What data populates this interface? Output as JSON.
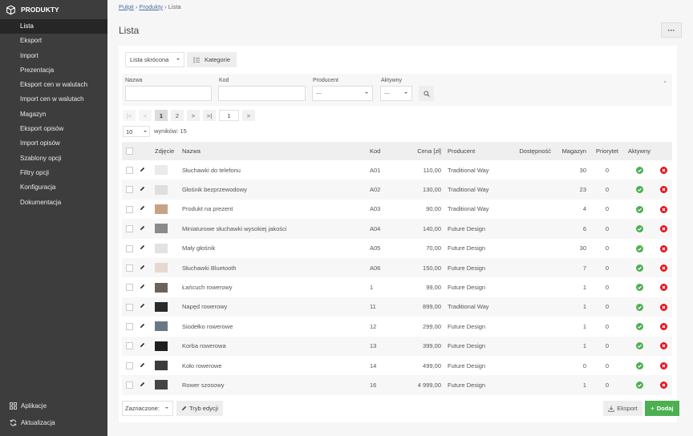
{
  "app": {
    "brand": "PRODUKTY"
  },
  "sidebar": {
    "items": [
      {
        "label": "Lista",
        "active": true
      },
      {
        "label": "Eksport"
      },
      {
        "label": "Import"
      },
      {
        "label": "Prezentacja"
      },
      {
        "label": "Eksport cen w walutach"
      },
      {
        "label": "Import cen w walutach"
      },
      {
        "label": "Magazyn"
      },
      {
        "label": "Eksport opisów"
      },
      {
        "label": "Import opisów"
      },
      {
        "label": "Szablony opcji"
      },
      {
        "label": "Filtry opcji"
      },
      {
        "label": "Konfiguracja"
      },
      {
        "label": "Dokumentacja"
      }
    ],
    "bottom": [
      {
        "label": "Aplikacje",
        "icon": "grid-icon"
      },
      {
        "label": "Aktualizacja",
        "icon": "refresh-icon"
      }
    ]
  },
  "breadcrumb": {
    "items": [
      "Pulpit",
      "Produkty",
      "Lista"
    ],
    "separator": "›"
  },
  "header": {
    "title": "Lista",
    "more_label": "···"
  },
  "toolbar": {
    "view_select": "Lista skrócona",
    "categories_label": "Kategorie"
  },
  "filters": {
    "name_label": "Nazwa",
    "name_value": "",
    "code_label": "Kod",
    "code_value": "",
    "producer_label": "Producent",
    "producer_value": "—",
    "active_label": "Aktywny",
    "active_value": "—"
  },
  "pagination": {
    "first": "|<",
    "prev": "<",
    "pages": [
      "1",
      "2"
    ],
    "current": "1",
    "next": ">",
    "last": ">|",
    "goto_value": "1",
    "goto_btn": ">"
  },
  "per_page": {
    "value": "10",
    "results_label": "wyników: 15"
  },
  "table": {
    "columns": [
      "",
      "",
      "Zdjęcie",
      "Nazwa",
      "Kod",
      "Cena [zł]",
      "Producent",
      "Dostępność",
      "Magazyn",
      "Priorytet",
      "Aktywny",
      ""
    ],
    "rows": [
      {
        "name": "Słuchawki do telefonu",
        "code": "A01",
        "price": "110,00",
        "producer": "Traditional Way",
        "availability": "",
        "stock": "30",
        "priority": "0",
        "active": true,
        "thumb": "#e9ebec"
      },
      {
        "name": "Głośnik bezprzewodowy",
        "code": "A02",
        "price": "130,00",
        "producer": "Traditional Way",
        "availability": "",
        "stock": "23",
        "priority": "0",
        "active": true,
        "thumb": "#dedede"
      },
      {
        "name": "Produkt na prezent",
        "code": "A03",
        "price": "90,00",
        "producer": "Traditional Way",
        "availability": "",
        "stock": "4",
        "priority": "0",
        "active": true,
        "thumb": "#c9a283"
      },
      {
        "name": "Miniaturowe słuchawki wysokiej jakości",
        "code": "A04",
        "price": "140,00",
        "producer": "Future Design",
        "availability": "",
        "stock": "6",
        "priority": "0",
        "active": true,
        "thumb": "#8a8a8a"
      },
      {
        "name": "Mały głośnik",
        "code": "A05",
        "price": "70,00",
        "producer": "Future Design",
        "availability": "",
        "stock": "30",
        "priority": "0",
        "active": true,
        "thumb": "#e2e2e2"
      },
      {
        "name": "Słuchawki Bluetooth",
        "code": "A06",
        "price": "150,00",
        "producer": "Future Design",
        "availability": "",
        "stock": "7",
        "priority": "0",
        "active": true,
        "thumb": "#e8d8cf"
      },
      {
        "name": "Łańcuch rowerowy",
        "code": "1",
        "price": "99,00",
        "producer": "Future Design",
        "availability": "",
        "stock": "1",
        "priority": "0",
        "active": true,
        "thumb": "#6b635b"
      },
      {
        "name": "Napęd rowerowy",
        "code": "11",
        "price": "899,00",
        "producer": "Traditional Way",
        "availability": "",
        "stock": "1",
        "priority": "0",
        "active": true,
        "thumb": "#2a2a2a"
      },
      {
        "name": "Siodełko rowerowe",
        "code": "12",
        "price": "299,00",
        "producer": "Future Design",
        "availability": "",
        "stock": "1",
        "priority": "0",
        "active": true,
        "thumb": "#6a7886"
      },
      {
        "name": "Korba rowerowa",
        "code": "13",
        "price": "399,00",
        "producer": "Future Design",
        "availability": "",
        "stock": "1",
        "priority": "0",
        "active": true,
        "thumb": "#1f1f1f"
      },
      {
        "name": "Koło rowerowe",
        "code": "14",
        "price": "499,00",
        "producer": "Future Design",
        "availability": "",
        "stock": "0",
        "priority": "0",
        "active": true,
        "thumb": "#3c3c3c"
      },
      {
        "name": "Rower szosowy",
        "code": "16",
        "price": "4 999,00",
        "producer": "Future Design",
        "availability": "",
        "stock": "1",
        "priority": "0",
        "active": true,
        "thumb": "#454545"
      }
    ]
  },
  "footer": {
    "bulk_select": "Zaznaczone:",
    "edit_mode_label": "Tryb edycji",
    "export_label": "Eksport",
    "add_label": "Dodaj"
  },
  "colors": {
    "sidebar_bg": "#3d3d3d",
    "sidebar_active": "#262626",
    "accent_green": "#4caf50",
    "danger_red": "#e8131e",
    "link": "#4a6fa5"
  }
}
